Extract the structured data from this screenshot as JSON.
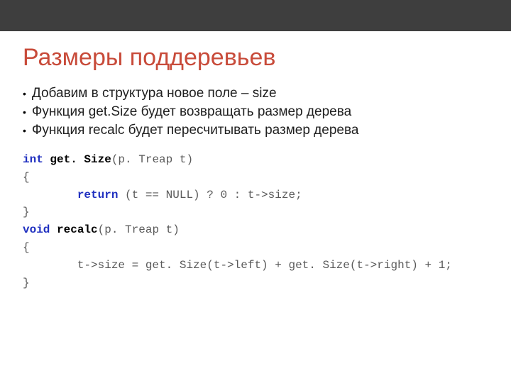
{
  "header": {
    "title": "Размеры поддеревьев"
  },
  "bullets": {
    "b1": "Добавим в структура новое поле – size",
    "b2": "Функция get.Size будет возвращать размер дерева",
    "b3": "Функция recalc будет пересчитывать размер дерева"
  },
  "code": {
    "l01_kw": "int",
    "l01_id": " get. Size",
    "l01_rest": "(p. Treap t)",
    "l02": "{",
    "l03_pre": "        ",
    "l03_kw": "return",
    "l03_rest": " (t == NULL) ? 0 : t->size;",
    "l04": "}",
    "l05": "",
    "l06_kw": "void",
    "l06_id": " recalc",
    "l06_rest": "(p. Treap t)",
    "l07": "{",
    "l08": "        t->size = get. Size(t->left) + get. Size(t->right) + 1;",
    "l09": "}"
  }
}
